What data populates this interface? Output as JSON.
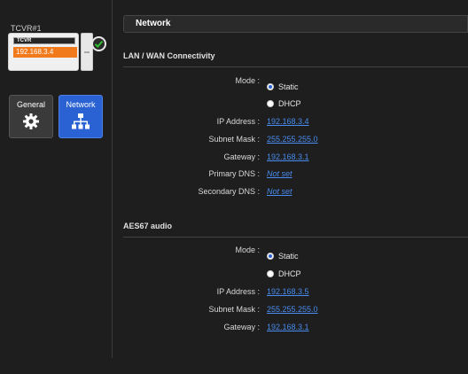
{
  "device": {
    "name": "TCVR#1",
    "card_label": "TCVR",
    "ip": "192.168.3.4"
  },
  "nav": {
    "general_label": "General",
    "network_label": "Network"
  },
  "header": {
    "title": "Network"
  },
  "lan": {
    "title": "LAN / WAN Connectivity",
    "mode_label": "Mode :",
    "mode_options": [
      "Static",
      "DHCP"
    ],
    "mode_selected": "Static",
    "ip_label": "IP Address :",
    "ip_value": "192.168.3.4",
    "subnet_label": "Subnet Mask :",
    "subnet_value": "255.255.255.0",
    "gateway_label": "Gateway :",
    "gateway_value": "192.168.3.1",
    "dns1_label": "Primary DNS :",
    "dns1_value": "Not set",
    "dns2_label": "Secondary DNS :",
    "dns2_value": "Not set"
  },
  "aes67": {
    "title": "AES67 audio",
    "mode_label": "Mode :",
    "mode_options": [
      "Static",
      "DHCP"
    ],
    "mode_selected": "Static",
    "ip_label": "IP Address :",
    "ip_value": "192.168.3.5",
    "subnet_label": "Subnet Mask :",
    "subnet_value": "255.255.255.0",
    "gateway_label": "Gateway :",
    "gateway_value": "192.168.3.1"
  },
  "colors": {
    "accent": "#2a62d4",
    "link": "#4a8cf0",
    "device_ip_bg": "#f07a1c",
    "status_ok": "#2fbf2f"
  },
  "icons": [
    "check-icon",
    "gear-icon",
    "network-icon"
  ]
}
